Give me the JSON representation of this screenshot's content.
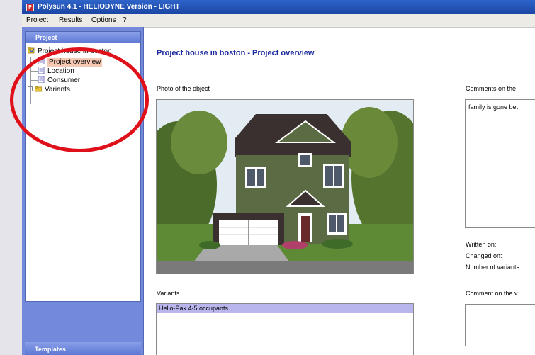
{
  "window": {
    "title": "Polysun 4.1 - HELIODYNE Version - LIGHT",
    "app_icon_glyph": "P"
  },
  "menu": [
    "Project",
    "Results",
    "Options",
    "?"
  ],
  "sidebar": {
    "project_header": "Project",
    "tree": {
      "root": "Project house in boston",
      "children": [
        {
          "label": "Project overview",
          "selected": true
        },
        {
          "label": "Location",
          "selected": false
        },
        {
          "label": "Consumer",
          "selected": false
        },
        {
          "label": "Variants",
          "selected": false
        }
      ]
    },
    "templates_header": "Templates"
  },
  "main": {
    "title": "Project house in boston - Project overview",
    "photo_label": "Photo of the object",
    "comments_label": "Comments on the",
    "comments_text": "family is gone bet",
    "info": {
      "written_on": "Written on:",
      "changed_on": "Changed on:",
      "num_variants": "Number of variants"
    },
    "variants_label": "Variants",
    "variants": [
      "Helio-Pak 4-5 occupants"
    ],
    "comment_variant_label": "Comment on the v"
  },
  "colors": {
    "titlebar": "#1b45a4",
    "sidebar": "#7389dc",
    "accent_text": "#1c2a9e",
    "highlight_circle": "#e0101a",
    "selection": "#f6c9b5",
    "variant_row": "#b8b6ec"
  }
}
